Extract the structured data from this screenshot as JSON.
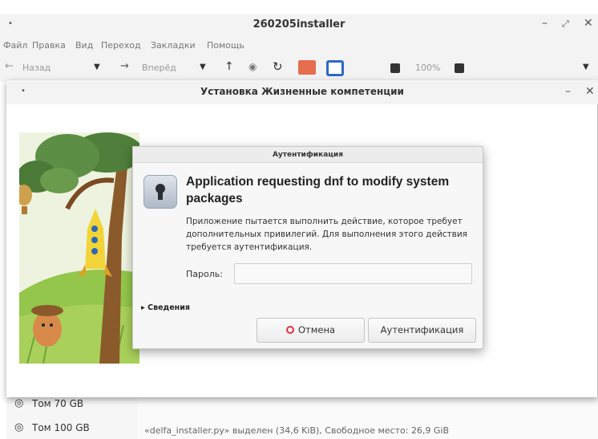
{
  "file_manager": {
    "window_title": "260205installer",
    "menu": [
      "Файл",
      "Правка",
      "Вид",
      "Переход",
      "Закладки",
      "Помощь"
    ],
    "toolbar": {
      "back": "Назад",
      "forward": "Вперёд",
      "zoom": "100%"
    },
    "sidebar": [
      {
        "icon": "drive-icon",
        "label": "Том 70 GB"
      },
      {
        "icon": "drive-icon",
        "label": "Том 100 GB"
      }
    ],
    "status": "«delfa_installer.py» выделен (34,6 KiB), Свободное место: 26,9 GiB"
  },
  "installer": {
    "window_title": "Установка Жизненные компетенции"
  },
  "auth_dialog": {
    "title": "Аутентификация",
    "heading": "Application requesting dnf to modify system packages",
    "message": "Приложение пытается выполнить действие, которое требует дополнительных привилегий. Для выполнения этого действия требуется аутентификация.",
    "password_label": "Пароль:",
    "password_value": "",
    "details_label": "Сведения",
    "cancel_label": "Отмена",
    "authenticate_label": "Аутентификация"
  }
}
